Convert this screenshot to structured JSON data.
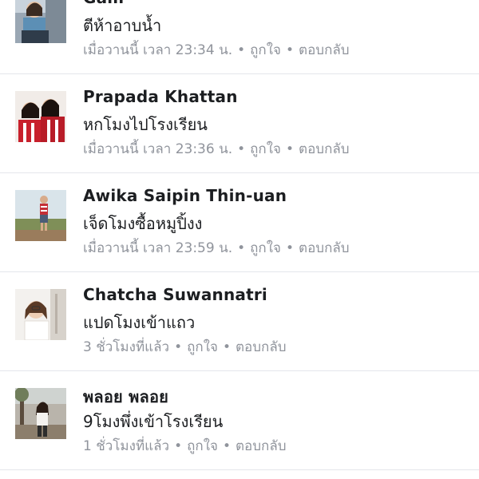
{
  "comments": [
    {
      "name": "Gam",
      "text": "ตีห้าอาบน้ำ",
      "time": "เมื่อวานนี้ เวลา 23:34 น.",
      "like": "ถูกใจ",
      "reply": "ตอบกลับ"
    },
    {
      "name": "Prapada Khattan",
      "text": "หกโมงไปโรงเรียน",
      "time": "เมื่อวานนี้ เวลา 23:36 น.",
      "like": "ถูกใจ",
      "reply": "ตอบกลับ"
    },
    {
      "name": "Awika Saipin Thin-uan",
      "text": "เจ็ดโมงซื้อหมูปิ้งง",
      "time": "เมื่อวานนี้ เวลา 23:59 น.",
      "like": "ถูกใจ",
      "reply": "ตอบกลับ"
    },
    {
      "name": "Chatcha Suwannatri",
      "text": "แปดโมงเข้าแถว",
      "time": "3 ชั่วโมงที่แล้ว",
      "like": "ถูกใจ",
      "reply": "ตอบกลับ"
    },
    {
      "name": "พลอย พลอย",
      "text": "9โมงพึ่งเข้าโรงเรียน",
      "time": "1 ชั่วโมงที่แล้ว",
      "like": "ถูกใจ",
      "reply": "ตอบกลับ"
    }
  ],
  "separator": "•",
  "colors": {
    "name": "#1c1e21",
    "meta": "#90949c",
    "divider": "#e4e6eb"
  }
}
